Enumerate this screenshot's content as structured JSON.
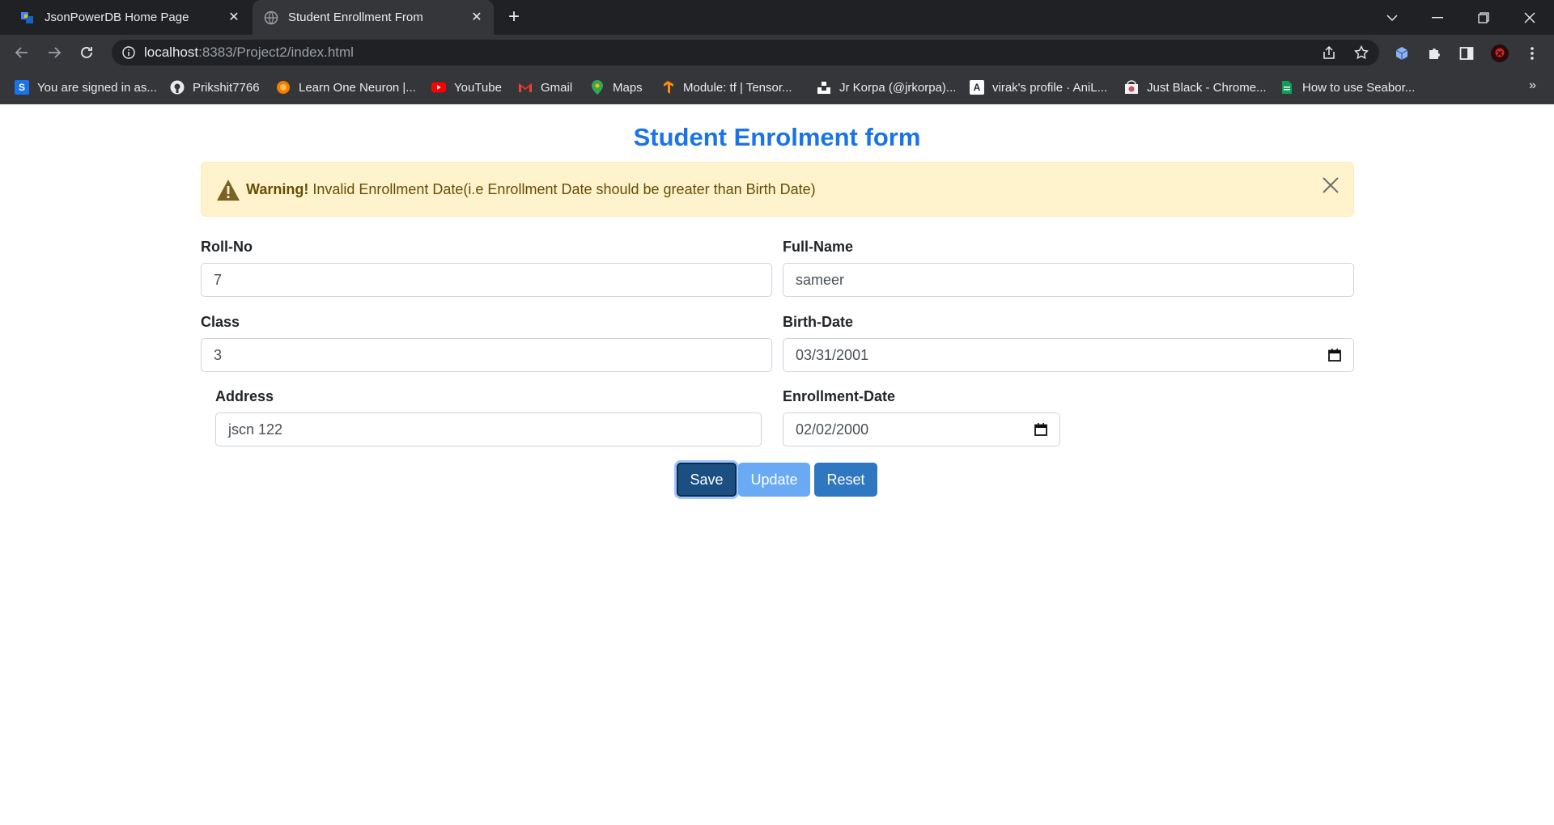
{
  "browser": {
    "tabs": [
      {
        "title": "JsonPowerDB Home Page",
        "active": false
      },
      {
        "title": "Student Enrollment From",
        "active": true
      }
    ],
    "url_host": "localhost",
    "url_rest": ":8383/Project2/index.html",
    "bookmarks": [
      {
        "label": "You are signed in as...",
        "icon": "s-icon"
      },
      {
        "label": "Prikshit7766",
        "icon": "github-icon"
      },
      {
        "label": "Learn One Neuron |...",
        "icon": "neuron-icon"
      },
      {
        "label": "YouTube",
        "icon": "youtube-icon"
      },
      {
        "label": "Gmail",
        "icon": "gmail-icon"
      },
      {
        "label": "Maps",
        "icon": "maps-icon"
      },
      {
        "label": "Module: tf  |  Tensor...",
        "icon": "tensorflow-icon"
      },
      {
        "label": "Jr Korpa (@jrkorpa)...",
        "icon": "unsplash-icon"
      },
      {
        "label": "virak's profile · AniL...",
        "icon": "anilist-icon"
      },
      {
        "label": "Just Black - Chrome...",
        "icon": "chrome-store-icon"
      },
      {
        "label": "How to use Seabor...",
        "icon": "bookmark-doc-icon"
      }
    ],
    "bookmarks_more": "»"
  },
  "page": {
    "title": "Student Enrolment form",
    "alert": {
      "strong": "Warning!",
      "message": " Invalid Enrollment Date(i.e Enrollment Date should be greater than Birth Date)"
    },
    "fields": {
      "roll_no": {
        "label": "Roll-No",
        "value": "7"
      },
      "full_name": {
        "label": "Full-Name",
        "value": "sameer"
      },
      "class": {
        "label": "Class",
        "value": "3"
      },
      "birth_date": {
        "label": "Birth-Date",
        "value": "03/31/2001"
      },
      "address": {
        "label": "Address",
        "value": "jscn 122"
      },
      "enrollment_date": {
        "label": "Enrollment-Date",
        "value": "02/02/2000"
      }
    },
    "buttons": {
      "save": "Save",
      "update": "Update",
      "reset": "Reset"
    }
  },
  "colors": {
    "title": "#1a73e8",
    "alert_bg": "#fff3cd",
    "alert_text": "#664d03",
    "save": "#1b4f82",
    "update": "#6aaaf5",
    "reset": "#2f77c0"
  }
}
